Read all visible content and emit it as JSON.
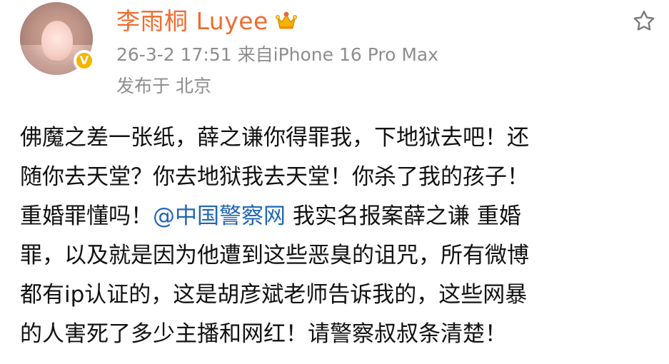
{
  "user": {
    "name": "李雨桐 Luyee",
    "verified_badge": "V"
  },
  "post": {
    "date": "26-3-2 17:51",
    "source": "来自iPhone 16 Pro Max",
    "location": "发布于 北京",
    "content": {
      "line1": "佛魔之差一张纸，薛之谦你得罪我，下地狱去吧！还",
      "line2": "随你去天堂？你去地狱我去天堂！你杀了我的孩子！",
      "line3_before": "重婚罪懂吗！",
      "mention": "@中国警察网",
      "line3_after": " 我实名报案薛之谦 重婚",
      "line4": "罪，以及就是因为他遭到这些恶臭的诅咒，所有微博",
      "line5": "都有ip认证的，这是胡彦斌老师告诉我的，这些网暴",
      "line6": "的人害死了多少主播和网红！请警察叔叔条清楚！"
    }
  },
  "icons": {
    "crown": "crown-icon",
    "favorite": "star-icon"
  },
  "colors": {
    "name": "#f06b2e",
    "meta": "#8d8d8d",
    "mention": "#1f66b3",
    "badge": "#f5b400"
  }
}
